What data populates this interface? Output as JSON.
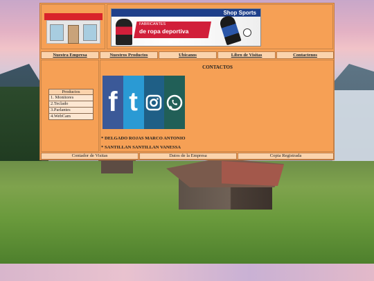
{
  "banner": {
    "brand": "Shop Sports",
    "tag_line1": "FABRICANTES",
    "tag_line2": "de ropa deportiva"
  },
  "nav": {
    "items": [
      {
        "label": "Nuestra Empresa"
      },
      {
        "label": "Nuestros Productos"
      },
      {
        "label": "Ubicanos"
      },
      {
        "label": "Libro de Visitas"
      },
      {
        "label": "Contactenos"
      }
    ]
  },
  "sidebar": {
    "menu_title": "Productos",
    "items": [
      {
        "label": "1. Monitores"
      },
      {
        "label": "2.Teclado"
      },
      {
        "label": "3.Parlantes"
      },
      {
        "label": "4.WebCam"
      }
    ]
  },
  "content": {
    "title": "CONTACTOS",
    "social_icons": [
      "facebook-icon",
      "twitter-icon",
      "instagram-icon",
      "whatsapp-icon"
    ],
    "contacts": [
      {
        "name": "* DELGADO ROJAS MARCO ANTONIO"
      },
      {
        "name": "* SANTILLAN SANTILLAN VANESSA"
      }
    ]
  },
  "footer": {
    "items": [
      {
        "label": "Contador de Visitas"
      },
      {
        "label": "Datos de la Empresa"
      },
      {
        "label": "Copia Registrada"
      }
    ]
  },
  "colors": {
    "page_background": "#f6a055",
    "nav_cell": "#fbd3ac",
    "facebook": "#3b5998",
    "twitter": "#2a9ad4",
    "instagram": "#1f5f86",
    "whatsapp": "#215f57"
  }
}
